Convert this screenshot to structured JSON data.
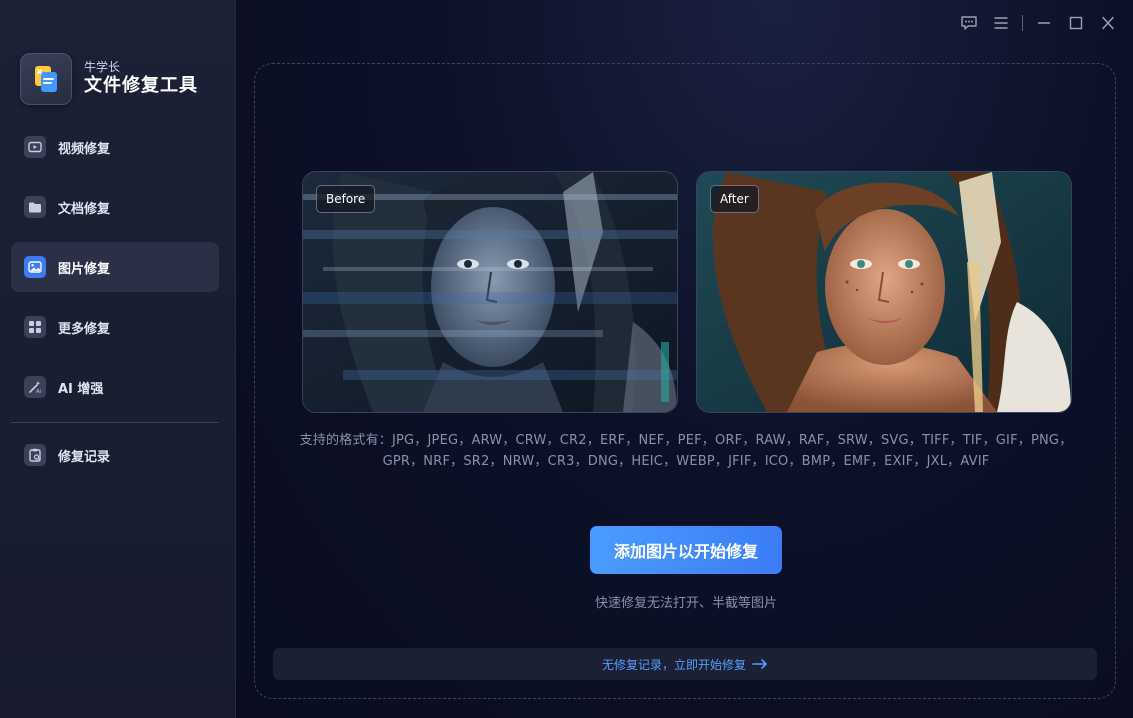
{
  "brand": {
    "subtitle": "牛学长",
    "title": "文件修复工具"
  },
  "sidebar": {
    "items": [
      {
        "label": "视频修复",
        "icon": "video-icon",
        "active": false
      },
      {
        "label": "文档修复",
        "icon": "folder-icon",
        "active": false
      },
      {
        "label": "图片修复",
        "icon": "image-icon",
        "active": true
      },
      {
        "label": "更多修复",
        "icon": "grid-icon",
        "active": false
      },
      {
        "label": "AI 增强",
        "icon": "ai-wand-icon",
        "active": false
      }
    ],
    "history": {
      "label": "修复记录",
      "icon": "clipboard-icon"
    }
  },
  "window_controls": [
    "feedback-icon",
    "menu-icon",
    "minimize-icon",
    "maximize-icon",
    "close-icon"
  ],
  "main": {
    "before_label": "Before",
    "after_label": "After",
    "formats_line1": "支持的格式有：JPG，JPEG，ARW，CRW，CR2，ERF，NEF，PEF，ORF，RAW，RAF，SRW，SVG，TIFF，TIF，GIF，PNG，",
    "formats_line2": "GPR，NRF，SR2，NRW，CR3，DNG，HEIC，WEBP，JFIF，ICO，BMP，EMF，EXIF，JXL，AVIF",
    "cta_label": "添加图片以开始修复",
    "cta_sub": "快速修复无法打开、半截等图片",
    "history_bar": "无修复记录，立即开始修复"
  },
  "colors": {
    "accent": "#3d7bf7",
    "cta_start": "#4b9cff",
    "link": "#5b9bff",
    "sidebar_bg": "#1c2135",
    "main_bg": "#0d1128"
  }
}
